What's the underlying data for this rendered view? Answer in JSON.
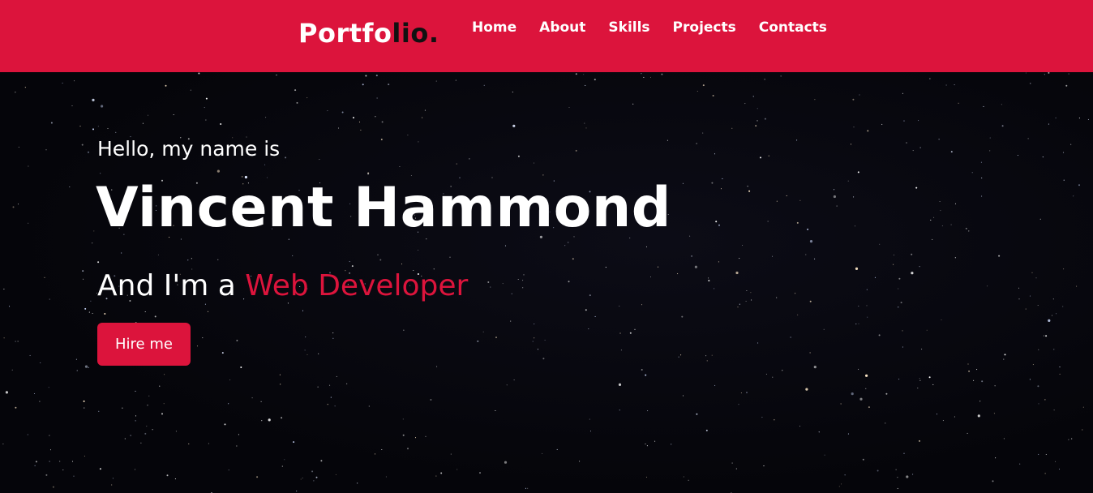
{
  "colors": {
    "brand": "#dc143c",
    "logo_accent": "#111111",
    "background": "#05050a",
    "text": "#ffffff"
  },
  "navbar": {
    "logo_main": "Portfo",
    "logo_accent": "lio.",
    "items": [
      "Home",
      "About",
      "Skills",
      "Projects",
      "Contacts"
    ]
  },
  "hero": {
    "greeting": "Hello, my name is",
    "name": "Vincent Hammond",
    "role_prefix": "And I'm a ",
    "role_highlight": "Web Developer",
    "cta_label": "Hire me"
  }
}
